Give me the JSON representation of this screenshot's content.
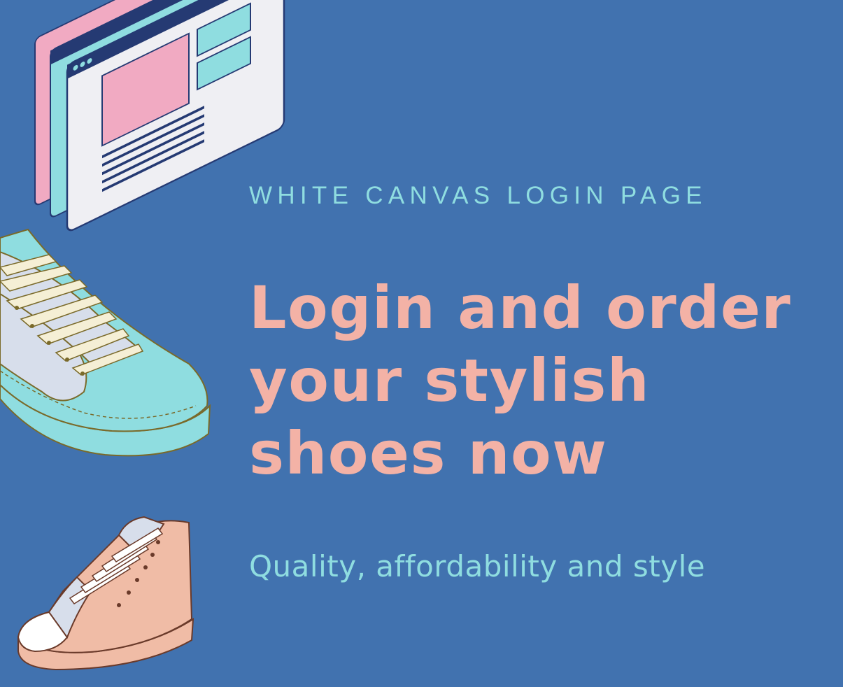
{
  "page": {
    "eyebrow": "WHITE CANVAS LOGIN PAGE",
    "headline": "Login and order\nyour stylish\nshoes now",
    "tagline": "Quality, affordability and style"
  },
  "colors": {
    "background": "#4172af",
    "eyebrow": "#8fdde0",
    "headline": "#f3b2a6",
    "tagline": "#8fdde0"
  },
  "illustrations": [
    "browser-windows-icon",
    "teal-sneaker-icon",
    "peach-high-top-sneaker-icon"
  ]
}
